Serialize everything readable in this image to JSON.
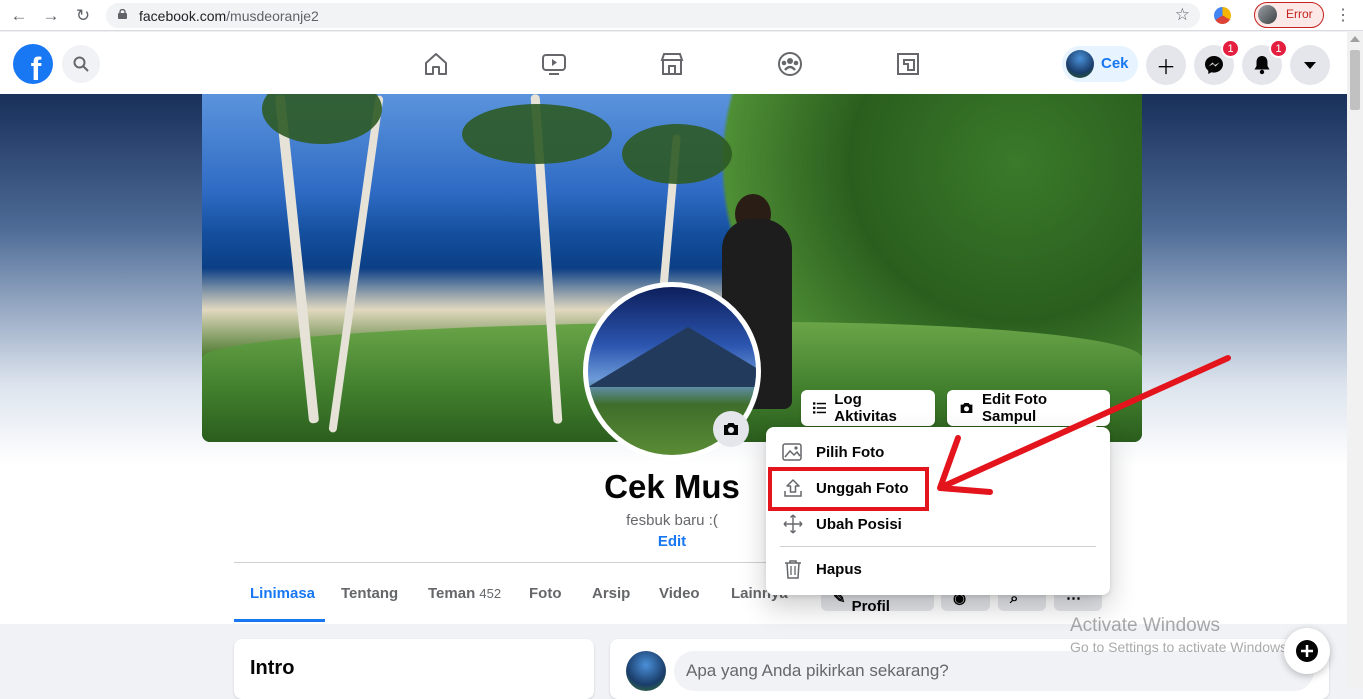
{
  "browser": {
    "url_host": "facebook.com",
    "url_path": "/musdeoranje2",
    "profile_status": "Error"
  },
  "topnav": {
    "user_short_name": "Cek",
    "messenger_badge": "1",
    "notifications_badge": "1"
  },
  "profile": {
    "name": "Cek Mus",
    "bio": "fesbuk baru :(",
    "edit_label": "Edit"
  },
  "cover_buttons": {
    "activity_log": "Log Aktivitas",
    "edit_cover": "Edit Foto Sampul"
  },
  "cover_menu": {
    "items": [
      {
        "label": "Pilih Foto",
        "icon": "photo-icon"
      },
      {
        "label": "Unggah Foto",
        "icon": "upload-icon",
        "highlighted": true
      },
      {
        "label": "Ubah Posisi",
        "icon": "move-icon"
      },
      {
        "label": "Hapus",
        "icon": "trash-icon"
      }
    ]
  },
  "tabs": [
    {
      "label": "Linimasa",
      "active": true
    },
    {
      "label": "Tentang"
    },
    {
      "label": "Teman",
      "count": "452"
    },
    {
      "label": "Foto"
    },
    {
      "label": "Arsip"
    },
    {
      "label": "Video"
    },
    {
      "label": "Lainnya"
    }
  ],
  "tab_actions": {
    "edit_profile": "Edit Profil"
  },
  "intro": {
    "title": "Intro"
  },
  "composer": {
    "placeholder": "Apa yang Anda pikirkan sekarang?"
  },
  "watermark": {
    "line1": "Activate Windows",
    "line2": "Go to Settings to activate Windows."
  },
  "colors": {
    "fb_blue": "#1877f2",
    "highlight_red": "#e3141c",
    "badge_red": "#e41e3f"
  }
}
